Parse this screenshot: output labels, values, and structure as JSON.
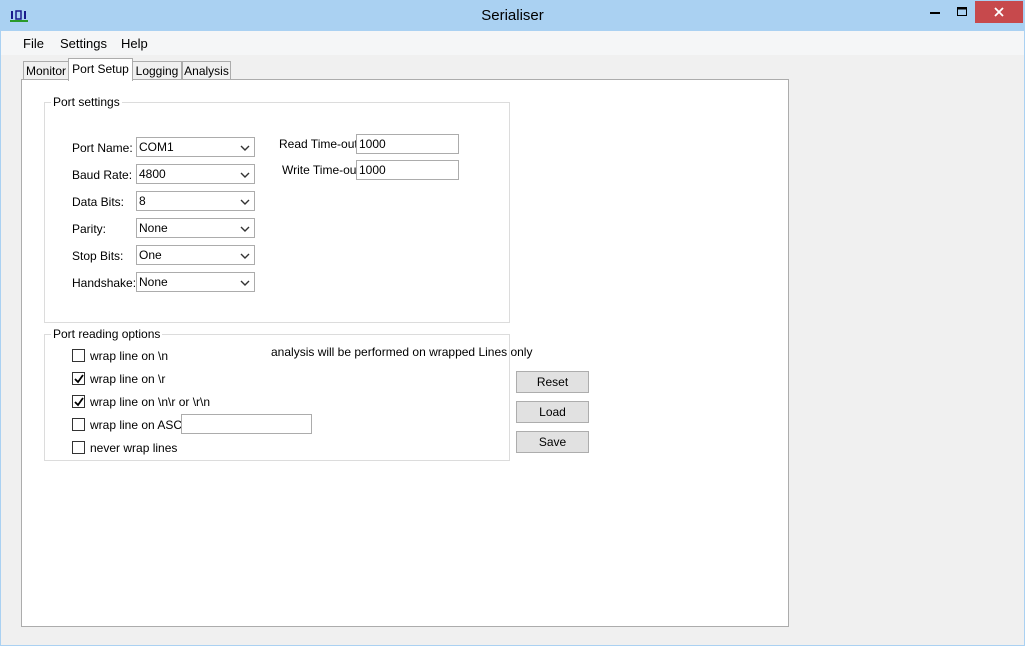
{
  "window": {
    "title": "Serialiser",
    "close_glyph": "✕",
    "min_glyph": "—",
    "max_glyph": "▢"
  },
  "menu": {
    "items": [
      "File",
      "Settings",
      "Help"
    ]
  },
  "tabs": [
    {
      "label": "Monitor",
      "active": false
    },
    {
      "label": "Port Setup",
      "active": true
    },
    {
      "label": "Logging",
      "active": false
    },
    {
      "label": "Analysis",
      "active": false
    }
  ],
  "port_settings": {
    "legend": "Port settings",
    "port_name": {
      "label": "Port Name:",
      "value": "COM1"
    },
    "baud_rate": {
      "label": "Baud Rate:",
      "value": "4800"
    },
    "data_bits": {
      "label": "Data Bits:",
      "value": "8"
    },
    "parity": {
      "label": "Parity:",
      "value": "None"
    },
    "stop_bits": {
      "label": "Stop Bits:",
      "value": "One"
    },
    "handshake": {
      "label": "Handshake:",
      "value": "None"
    },
    "read_timeout": {
      "label": "Read Time-out",
      "value": "1000"
    },
    "write_timeout": {
      "label": "Write Time-out",
      "value": "1000"
    }
  },
  "reading_options": {
    "legend": "Port reading options",
    "note": "analysis will be performed on wrapped Lines only",
    "options": [
      {
        "label": "wrap line on \\n",
        "checked": false
      },
      {
        "label": "wrap line on \\r",
        "checked": true
      },
      {
        "label": "wrap line on \\n\\r or \\r\\n",
        "checked": true
      },
      {
        "label": "wrap line on ASCII",
        "checked": false
      },
      {
        "label": "never wrap lines",
        "checked": false
      }
    ],
    "ascii_value": ""
  },
  "buttons": {
    "reset": "Reset",
    "load": "Load",
    "save": "Save"
  },
  "icons": {
    "app": "app-icon",
    "dropdown": "chevron-down-icon",
    "check": "checkmark-icon"
  }
}
